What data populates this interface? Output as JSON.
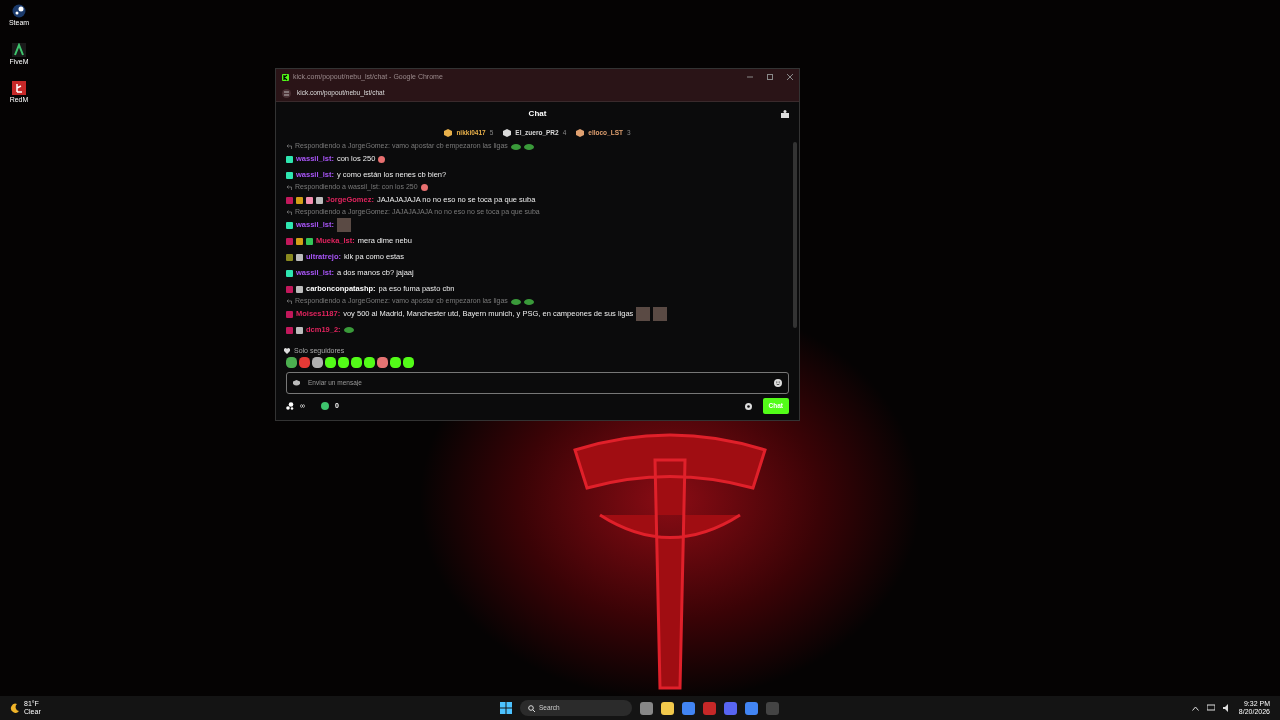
{
  "desktop_icons": [
    {
      "label": "Steam",
      "kind": "steam"
    },
    {
      "label": "FiveM",
      "kind": "fivem"
    },
    {
      "label": "RedM",
      "kind": "redm"
    }
  ],
  "window": {
    "title": "kick.com/popout/nebu_lst/chat - Google Chrome",
    "address": "kick.com/popout/nebu_lst/chat"
  },
  "chat": {
    "title": "Chat",
    "leaders": [
      {
        "name": "nikki0417",
        "count": "5",
        "color": "#e8b04a"
      },
      {
        "name": "El_zuero_PR2",
        "count": "4",
        "color": "#d9d9d9"
      },
      {
        "name": "elloco_LST",
        "count": "3",
        "color": "#e0a070"
      }
    ],
    "messages": [
      {
        "kind": "reply",
        "text": "Respondiendo a JorgeGomez: vamo apostar cb empezaron las ligas",
        "emotes": [
          {
            "kind": "blob"
          },
          {
            "kind": "blob"
          }
        ]
      },
      {
        "kind": "message",
        "badges": [
          {
            "color": "#2ee6b0"
          }
        ],
        "user": "wassil_lst:",
        "color": "#a855f7",
        "text": "con los 250",
        "emotes": [
          {
            "kind": "face"
          }
        ]
      },
      {
        "kind": "message",
        "badges": [
          {
            "color": "#2ee6b0"
          }
        ],
        "user": "wassil_lst:",
        "color": "#a855f7",
        "text": "y como están los nenes cb bien?"
      },
      {
        "kind": "reply",
        "text": "Respondiendo a wassil_lst: con los 250",
        "emotes": [
          {
            "kind": "face"
          }
        ]
      },
      {
        "kind": "message",
        "badges": [
          {
            "color": "#c2185b"
          },
          {
            "color": "#d4a017"
          },
          {
            "color": "#f48fb1"
          },
          {
            "color": "#bdbdbd"
          }
        ],
        "user": "JorgeGomez:",
        "color": "#e0245e",
        "text": "JAJAJAJAJA no no eso no se toca pa que suba"
      },
      {
        "kind": "reply",
        "text": "Respondiendo a JorgeGomez: JAJAJAJAJA no no eso no se toca pa que suba"
      },
      {
        "kind": "message",
        "badges": [
          {
            "color": "#2ee6b0"
          }
        ],
        "user": "wassil_lst:",
        "color": "#a855f7",
        "emotes": [
          {
            "kind": "photo"
          }
        ]
      },
      {
        "kind": "message",
        "badges": [
          {
            "color": "#c2185b"
          },
          {
            "color": "#d4a017"
          },
          {
            "color": "#34c759"
          }
        ],
        "user": "Mueka_lst:",
        "color": "#e0245e",
        "text": "mera dime nebu"
      },
      {
        "kind": "message",
        "badges": [
          {
            "color": "#8a8a20"
          },
          {
            "color": "#bdbdbd"
          }
        ],
        "user": "ultratrejo:",
        "color": "#a855f7",
        "text": "klk pa como estas"
      },
      {
        "kind": "message",
        "badges": [
          {
            "color": "#2ee6b0"
          }
        ],
        "user": "wassil_lst:",
        "color": "#a855f7",
        "text": "a dos manos cb? jajaaj"
      },
      {
        "kind": "message",
        "badges": [
          {
            "color": "#c2185b"
          },
          {
            "color": "#bdbdbd"
          }
        ],
        "user": "carbonconpatashp:",
        "color": "#ffffff",
        "text": "pa eso fuma pasto cbn"
      },
      {
        "kind": "reply",
        "text": "Respondiendo a JorgeGomez: vamo apostar cb empezaron las ligas",
        "emotes": [
          {
            "kind": "blob"
          },
          {
            "kind": "blob"
          }
        ]
      },
      {
        "kind": "message",
        "badges": [
          {
            "color": "#c2185b"
          }
        ],
        "user": "Moises1187:",
        "color": "#e0245e",
        "text": "voy 500 al Madrid, Manchester utd, Bayern munich, y PSG, en campeones de sus ligas",
        "emotes": [
          {
            "kind": "photo"
          },
          {
            "kind": "photo"
          }
        ]
      },
      {
        "kind": "message",
        "badges": [
          {
            "color": "#c2185b"
          },
          {
            "color": "#bdbdbd"
          }
        ],
        "user": "dcm19_2:",
        "color": "#e0245e",
        "emotes": [
          {
            "kind": "blob"
          }
        ]
      }
    ],
    "mode": "Solo seguidores",
    "emote_bar": [
      {
        "color": "#4caf50"
      },
      {
        "color": "#e53935"
      },
      {
        "color": "#b0b0b0"
      },
      {
        "color": "#53fc18"
      },
      {
        "color": "#53fc18"
      },
      {
        "color": "#53fc18"
      },
      {
        "color": "#53fc18"
      },
      {
        "color": "#e57373"
      },
      {
        "color": "#53fc18"
      },
      {
        "color": "#53fc18"
      }
    ],
    "input": {
      "placeholder": "Enviar un mensaje"
    },
    "points_label": "∞",
    "kicks": "0",
    "send_button": "Chat"
  },
  "taskbar": {
    "weather_temp": "81°F",
    "weather_text": "Clear",
    "search_placeholder": "Search",
    "time": "9:32 PM",
    "date": "8/20/2026"
  }
}
